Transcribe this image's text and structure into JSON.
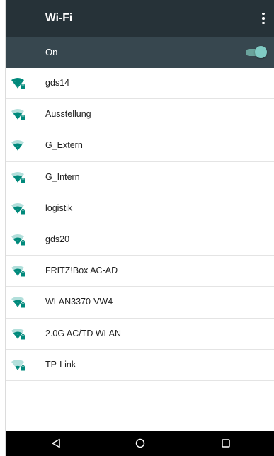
{
  "toolbar": {
    "title": "Wi-Fi",
    "menu_icon": "more-vert-icon"
  },
  "master_switch": {
    "label": "On",
    "state": true,
    "accent_color": "#80cbc4"
  },
  "networks": [
    {
      "ssid": "gds14",
      "signal": 4,
      "secured": true
    },
    {
      "ssid": "Ausstellung",
      "signal": 3,
      "secured": true
    },
    {
      "ssid": "G_Extern",
      "signal": 3,
      "secured": false
    },
    {
      "ssid": "G_Intern",
      "signal": 3,
      "secured": true
    },
    {
      "ssid": "logistik",
      "signal": 3,
      "secured": true
    },
    {
      "ssid": "gds20",
      "signal": 3,
      "secured": true
    },
    {
      "ssid": "FRITZ!Box AC-AD",
      "signal": 3,
      "secured": true
    },
    {
      "ssid": "WLAN3370-VW4",
      "signal": 3,
      "secured": true
    },
    {
      "ssid": "2.0G AC/TD WLAN",
      "signal": 3,
      "secured": true
    },
    {
      "ssid": "TP-Link",
      "signal": 2,
      "secured": true
    }
  ],
  "navbar": {
    "back_icon": "back-triangle-icon",
    "home_icon": "home-circle-icon",
    "recent_icon": "recent-apps-square-icon"
  },
  "colors": {
    "toolbar_bg": "#263238",
    "switch_bar_bg": "#37474f",
    "wifi_teal": "#00897b"
  }
}
